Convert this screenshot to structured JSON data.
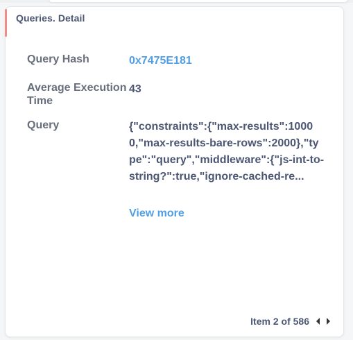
{
  "card": {
    "title": "Queries. Detail"
  },
  "fields": {
    "query_hash": {
      "label": "Query Hash",
      "value": "0x7475E181"
    },
    "avg_execution_time": {
      "label": "Average Execution Time",
      "value": "43"
    },
    "query": {
      "label": "Query",
      "value": "{\"constraints\":{\"max-results\":10000,\"max-results-bare-rows\":2000},\"type\":\"query\",\"middleware\":{\"js-int-to-string?\":true,\"ignore-cached-re..."
    }
  },
  "view_more_label": "View more",
  "pagination": {
    "text": "Item 2 of 586",
    "prev_icon": "caret-left-icon",
    "next_icon": "caret-right-icon"
  },
  "colors": {
    "accent": "#ef8c8c",
    "link": "#509ee3",
    "text": "#4c5773",
    "label": "#696e7b"
  }
}
